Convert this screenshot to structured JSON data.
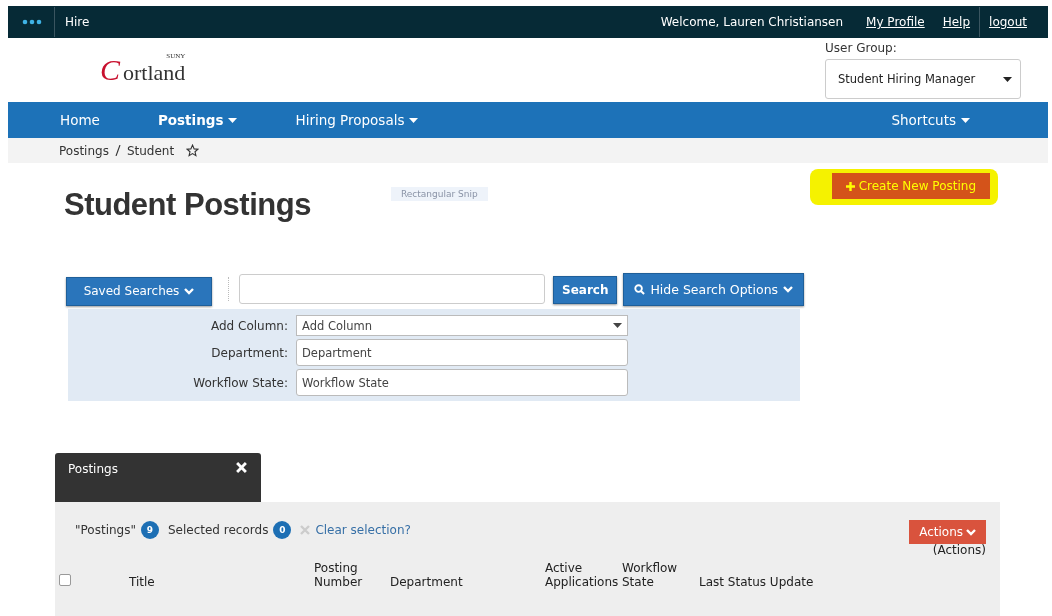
{
  "topbar": {
    "app": "Hire",
    "welcome": "Welcome, Lauren Christiansen",
    "links": [
      "My Profile",
      "Help",
      "logout"
    ]
  },
  "header": {
    "logo_small": "SUNY",
    "logo_initial": "C",
    "logo_rest": "ortland",
    "user_group_label": "User Group:",
    "user_group": "Student Hiring Manager"
  },
  "nav": {
    "items": [
      {
        "label": "Home",
        "selected": false,
        "dropdown": false
      },
      {
        "label": "Postings",
        "selected": true,
        "dropdown": true
      },
      {
        "label": "Hiring Proposals",
        "selected": false,
        "dropdown": true
      }
    ],
    "shortcuts": "Shortcuts"
  },
  "breadcrumb": [
    "Postings",
    "Student"
  ],
  "page_title": "Student Postings",
  "snip_tooltip": "Rectangular Snip",
  "create_button": "Create New Posting",
  "search": {
    "saved_searches": "Saved Searches",
    "search_button": "Search",
    "hide_options": "Hide Search Options",
    "filters": [
      {
        "label": "Add Column:",
        "kind": "select",
        "value": "Add Column"
      },
      {
        "label": "Department:",
        "kind": "text",
        "placeholder": "Department"
      },
      {
        "label": "Workflow State:",
        "kind": "text",
        "placeholder": "Workflow State"
      }
    ]
  },
  "panel": {
    "tab": "Postings",
    "select_all_checked": false,
    "list_label": "\"Postings\"",
    "count": "9",
    "selected_label": "Selected records",
    "selected_count": "0",
    "clear": "Clear selection?",
    "actions": "Actions",
    "actions_caption": "(Actions)",
    "columns": [
      "Title",
      "Posting Number",
      "Department",
      "Active Applications",
      "Workflow State",
      "Last Status Update"
    ]
  }
}
